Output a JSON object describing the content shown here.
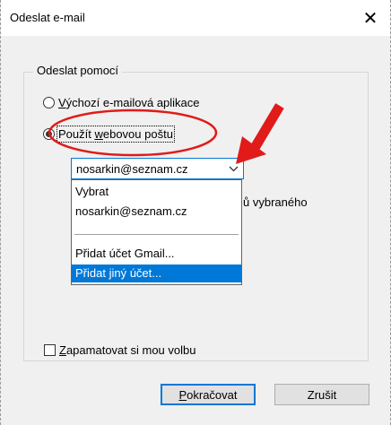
{
  "window": {
    "title": "Odeslat e-mail",
    "close_glyph": "✕"
  },
  "group": {
    "legend": "Odeslat pomocí"
  },
  "options": {
    "default_app": {
      "underlined": "V",
      "rest": "ýchozí e-mailová aplikace",
      "checked": false
    },
    "webmail": {
      "before": "Použít ",
      "underlined": "w",
      "rest": "ebovou poštu",
      "checked": true
    }
  },
  "account_select": {
    "value": "nosarkin@seznam.cz",
    "arrow_icon": "chevron-down-icon"
  },
  "dropdown": {
    "items": [
      "Vybrat",
      "nosarkin@seznam.cz",
      "Přidat účet Gmail...",
      "Přidat jiný účet..."
    ],
    "selected_index": 3
  },
  "behind_text": "ů vybraného",
  "remember": {
    "underlined": "Z",
    "rest": "apamatovat si mou volbu",
    "checked": false
  },
  "buttons": {
    "continue": {
      "underlined": "P",
      "rest": "okračovat"
    },
    "cancel": "Zrušit"
  },
  "annotation_color": "#e11a1a"
}
